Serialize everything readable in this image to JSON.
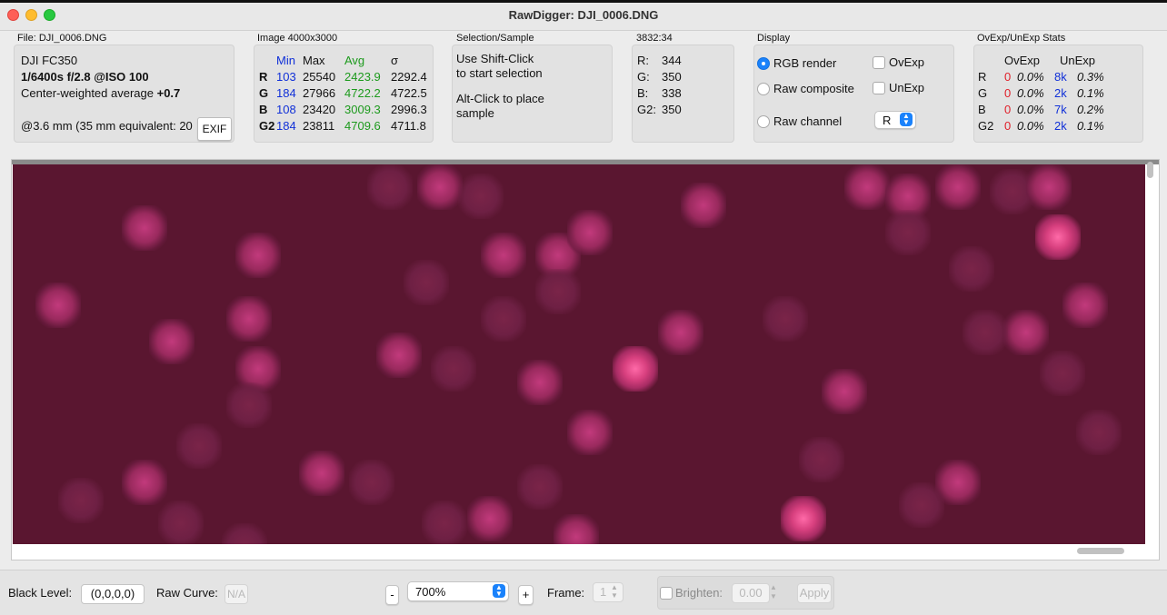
{
  "window": {
    "title": "RawDigger: DJI_0006.DNG"
  },
  "file_panel": {
    "caption": "File: DJI_0006.DNG",
    "camera": "DJI FC350",
    "exposure": "1/6400s f/2.8 @ISO 100",
    "metering": "Center-weighted average",
    "ev": "+0.7",
    "focal": "@3.6 mm (35 mm equivalent: 20",
    "exif_label": "EXIF"
  },
  "image_panel": {
    "caption": "Image 4000x3000",
    "headers": [
      "Min",
      "Max",
      "Avg",
      "σ"
    ],
    "rows": [
      {
        "ch": "R",
        "min": "103",
        "max": "25540",
        "avg": "2423.9",
        "sd": "2292.4"
      },
      {
        "ch": "G",
        "min": "184",
        "max": "27966",
        "avg": "4722.2",
        "sd": "4722.5"
      },
      {
        "ch": "B",
        "min": "108",
        "max": "23420",
        "avg": "3009.3",
        "sd": "2996.3"
      },
      {
        "ch": "G2",
        "min": "184",
        "max": "23811",
        "avg": "4709.6",
        "sd": "4711.8"
      }
    ]
  },
  "selection_panel": {
    "caption": "Selection/Sample",
    "line1": "Use Shift-Click",
    "line2": "to start selection",
    "line3": "Alt-Click to place",
    "line4": "sample"
  },
  "pixel_panel": {
    "caption": "3832:34",
    "rows": [
      {
        "label": "R:",
        "value": "344"
      },
      {
        "label": "G:",
        "value": "350"
      },
      {
        "label": "B:",
        "value": "338"
      },
      {
        "label": "G2:",
        "value": "350"
      }
    ]
  },
  "display_panel": {
    "caption": "Display",
    "rgb_render": "RGB render",
    "raw_composite": "Raw composite",
    "raw_channel": "Raw channel",
    "ovexp": "OvExp",
    "unexp": "UnExp",
    "channel_value": "R",
    "selected": "RGB render"
  },
  "stats_panel": {
    "caption": "OvExp/UnExp Stats",
    "headers": [
      "OvExp",
      "UnExp"
    ],
    "rows": [
      {
        "ch": "R",
        "ov_n": "0",
        "ov_p": "0.0%",
        "un_n": "8k",
        "un_p": "0.3%"
      },
      {
        "ch": "G",
        "ov_n": "0",
        "ov_p": "0.0%",
        "un_n": "2k",
        "un_p": "0.1%"
      },
      {
        "ch": "B",
        "ov_n": "0",
        "ov_p": "0.0%",
        "un_n": "7k",
        "un_p": "0.2%"
      },
      {
        "ch": "G2",
        "ov_n": "0",
        "ov_p": "0.0%",
        "un_n": "2k",
        "un_p": "0.1%"
      }
    ]
  },
  "bottom": {
    "black_level_label": "Black Level:",
    "black_level_value": "(0,0,0,0)",
    "raw_curve_label": "Raw Curve:",
    "raw_curve_value": "N/A",
    "zoom_minus": "-",
    "zoom_value": "700%",
    "zoom_plus": "+",
    "frame_label": "Frame:",
    "frame_value": "1",
    "brighten_label": "Brighten:",
    "brighten_value": "0.00",
    "apply_label": "Apply"
  },
  "colors": {
    "accent": "#1a82fb",
    "image_bg": "#5a1630",
    "min_col": "#1030d8",
    "avg_col": "#1d9a1d",
    "ov_col": "#e0202a"
  }
}
